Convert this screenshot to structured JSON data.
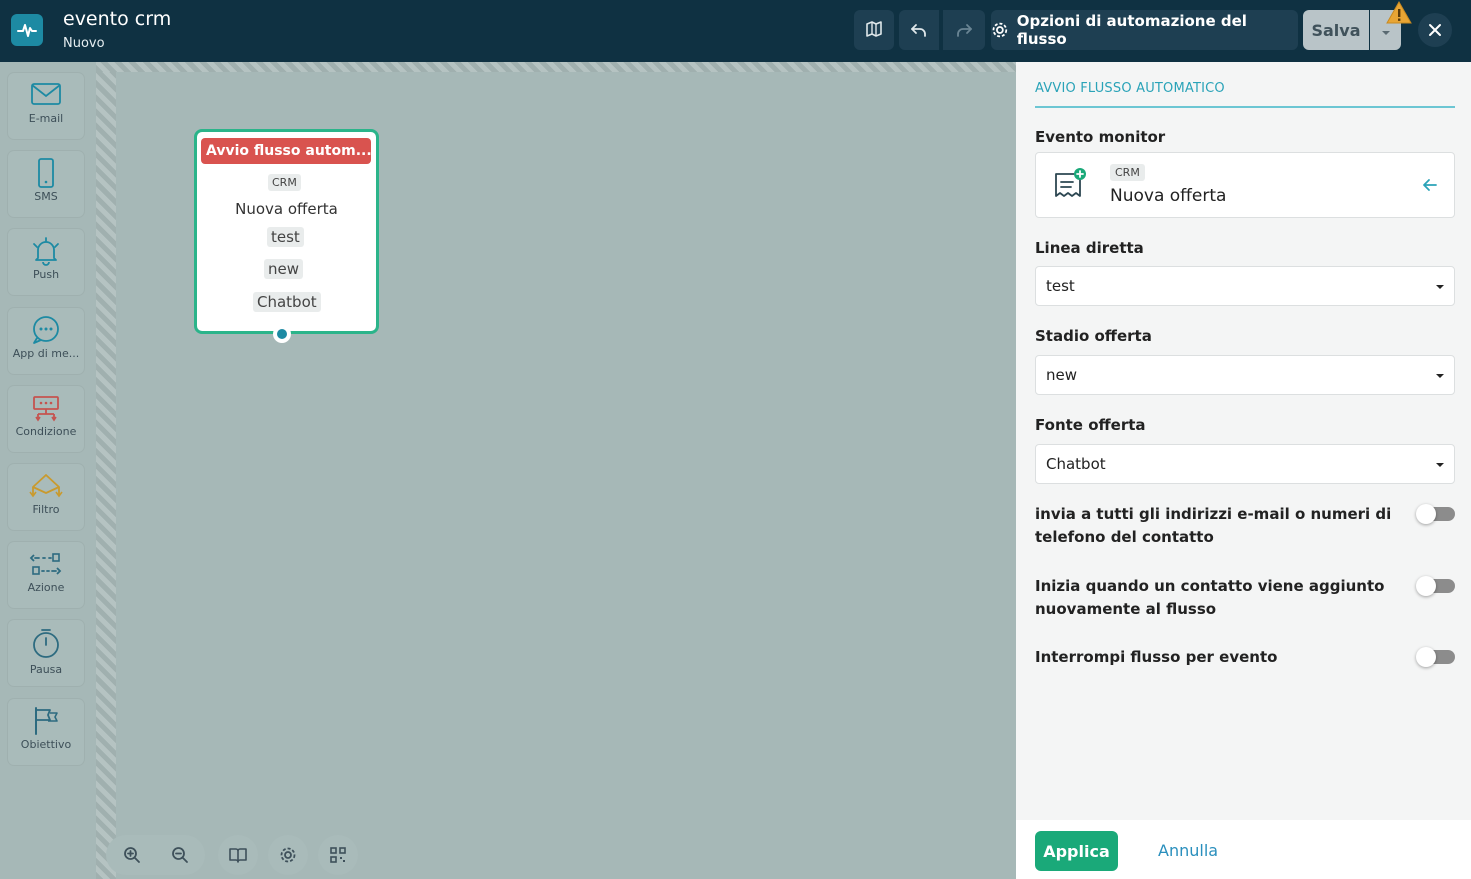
{
  "header": {
    "title": "evento crm",
    "subtitle": "Nuovo",
    "options_label": "Opzioni di automazione del flusso",
    "save_label": "Salva"
  },
  "sidebar": {
    "items": [
      {
        "label": "E-mail",
        "icon": "mail-icon"
      },
      {
        "label": "SMS",
        "icon": "phone-icon"
      },
      {
        "label": "Push",
        "icon": "bell-icon"
      },
      {
        "label": "App di me...",
        "icon": "chat-bubble-icon"
      },
      {
        "label": "Condizione",
        "icon": "condition-icon"
      },
      {
        "label": "Filtro",
        "icon": "filter-icon"
      },
      {
        "label": "Azione",
        "icon": "action-icon"
      },
      {
        "label": "Pausa",
        "icon": "timer-icon"
      },
      {
        "label": "Obiettivo",
        "icon": "flag-icon"
      }
    ]
  },
  "node": {
    "title": "Avvio flusso autom...",
    "crm_tag": "CRM",
    "event": "Nuova offerta",
    "tags": [
      "test",
      "new",
      "Chatbot"
    ]
  },
  "panel": {
    "title": "AVVIO FLUSSO AUTOMATICO",
    "monitor_label": "Evento monitor",
    "monitor_crm": "CRM",
    "monitor_event": "Nuova offerta",
    "line_label": "Linea diretta",
    "line_value": "test",
    "stage_label": "Stadio offerta",
    "stage_value": "new",
    "source_label": "Fonte offerta",
    "source_value": "Chatbot",
    "toggles": [
      {
        "label": "invia a tutti gli indirizzi e-mail o numeri di telefono del contatto",
        "on": false
      },
      {
        "label": "Inizia quando un contatto viene aggiunto nuovamente al flusso",
        "on": false
      },
      {
        "label": "Interrompi flusso per evento",
        "on": false
      }
    ],
    "apply_label": "Applica",
    "cancel_label": "Annulla"
  },
  "colors": {
    "header_bg": "#0f3142",
    "accent": "#2aa3b8",
    "node_head": "#d9534f",
    "node_border": "#2bb48a",
    "apply": "#1aa979"
  }
}
